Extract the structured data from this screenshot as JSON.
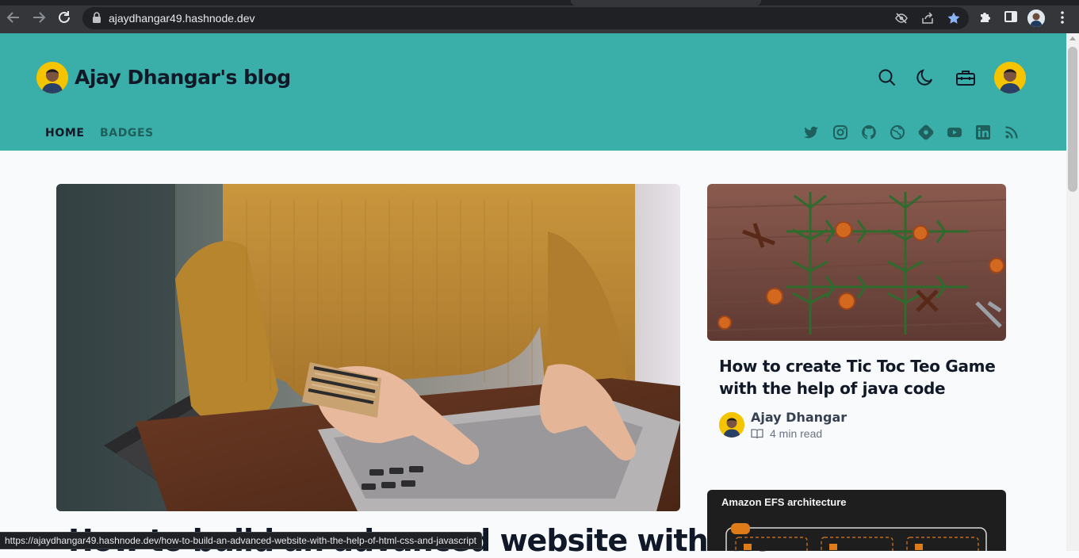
{
  "browser": {
    "url": "ajaydhangar49.hashnode.dev",
    "status_url": "https://ajaydhangar49.hashnode.dev/how-to-build-an-advanced-website-with-the-help-of-html-css-and-javascript",
    "icons": [
      "back-arrow-icon",
      "forward-arrow-icon",
      "reload-icon",
      "lock-icon",
      "eye-off-icon",
      "share-icon",
      "star-icon",
      "puzzle-icon",
      "sidebar-icon",
      "profile-avatar",
      "kebab-menu-icon"
    ]
  },
  "site": {
    "title": "Ajay Dhangar's blog",
    "header_icons": [
      "search-icon",
      "moon-icon",
      "toolbox-icon",
      "avatar"
    ],
    "nav": [
      {
        "label": "HOME",
        "active": true
      },
      {
        "label": "BADGES",
        "active": false
      }
    ],
    "social_icons": [
      "twitter-icon",
      "instagram-icon",
      "github-icon",
      "globe-icon",
      "hashnode-icon",
      "youtube-icon",
      "linkedin-icon",
      "rss-icon"
    ],
    "accent": "#3aaea8"
  },
  "main": {
    "hero_title": "How to build an advanced website with the"
  },
  "sidebar": {
    "card1": {
      "title": "How to create Tic Toc Teo Game with the help of java code",
      "author": "Ajay Dhangar",
      "read_time": "4 min read"
    },
    "card2": {
      "caption": "Amazon EFS architecture"
    }
  }
}
